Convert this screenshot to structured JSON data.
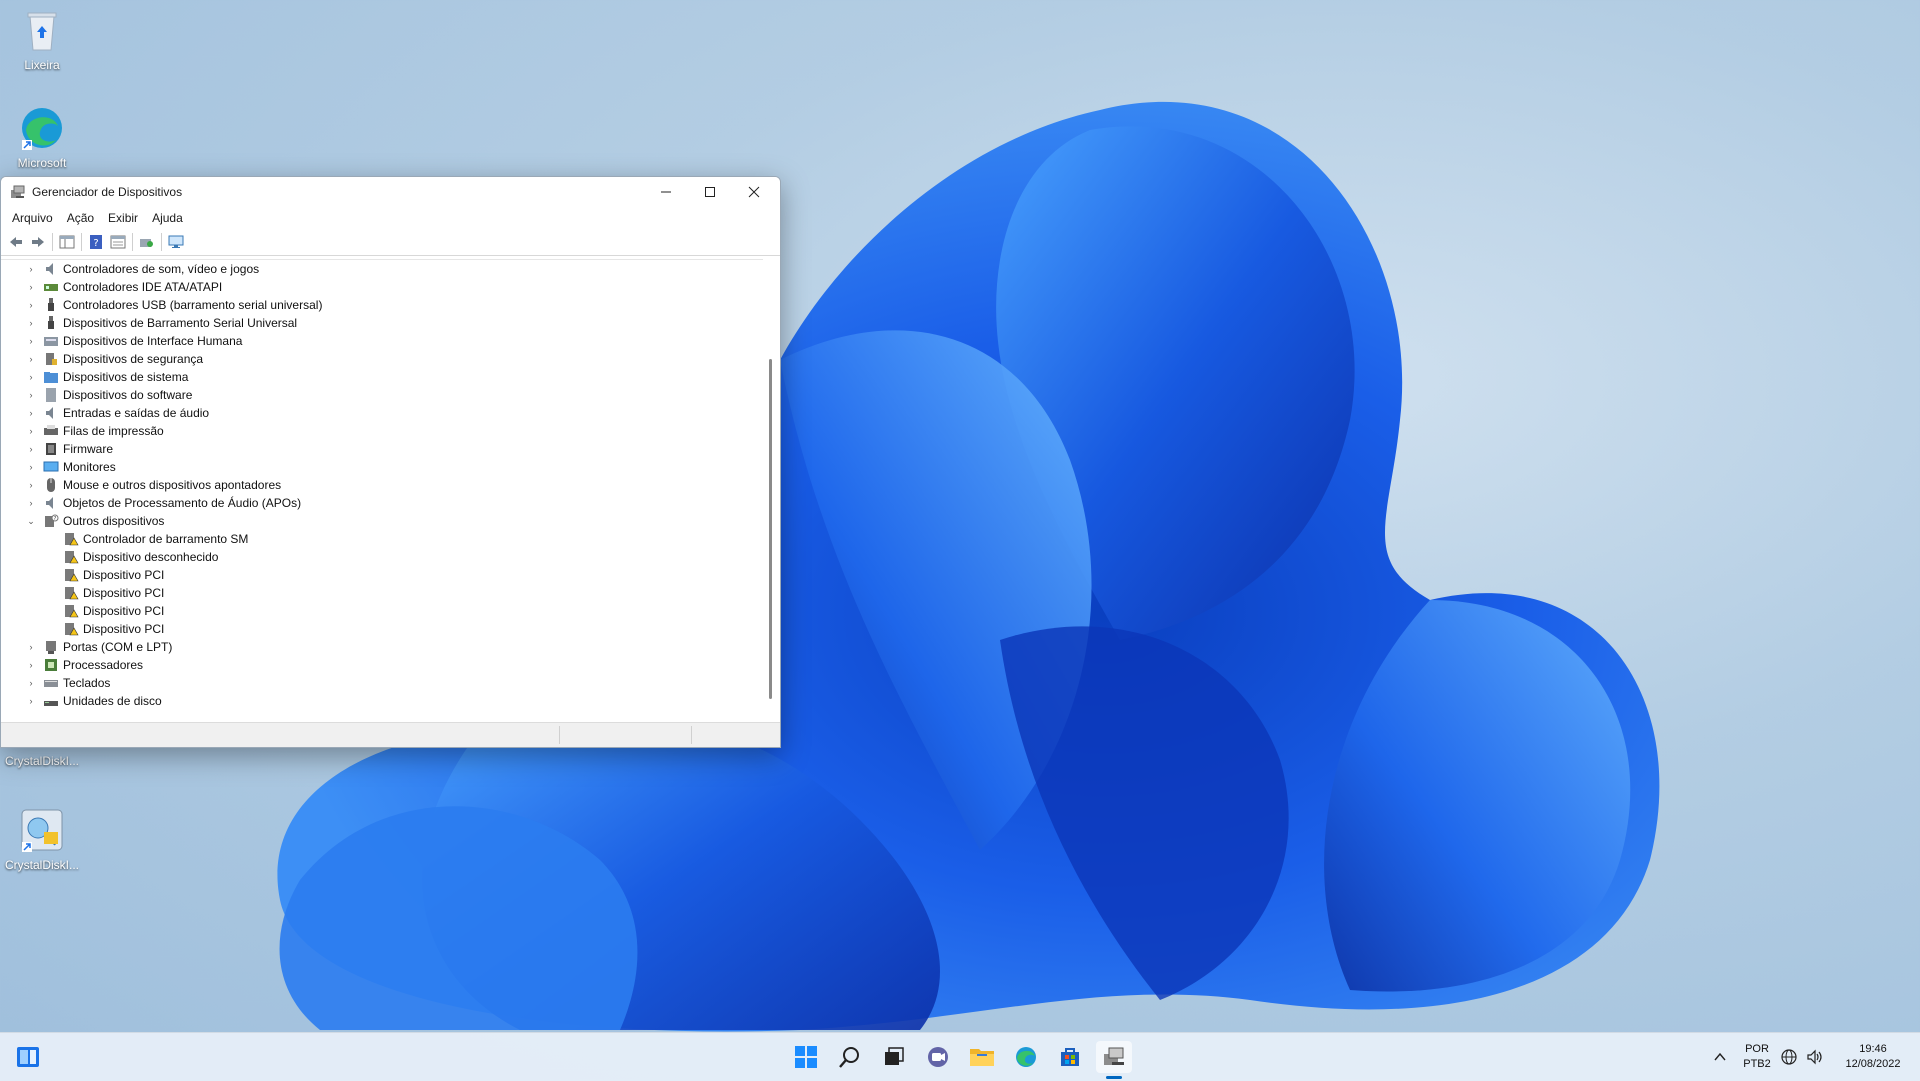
{
  "desktop": {
    "icons": [
      {
        "label": "Lixeira"
      },
      {
        "label": "Microsoft"
      },
      {
        "label": "CrystalDiskI..."
      },
      {
        "label": "CrystalDiskI..."
      }
    ]
  },
  "window": {
    "title": "Gerenciador de Dispositivos",
    "menu": [
      "Arquivo",
      "Ação",
      "Exibir",
      "Ajuda"
    ],
    "tree": [
      {
        "label": "Controladores de som, vídeo e jogos",
        "icon": "speaker-icon"
      },
      {
        "label": "Controladores IDE ATA/ATAPI",
        "icon": "ide-controller-icon"
      },
      {
        "label": "Controladores USB (barramento serial universal)",
        "icon": "usb-icon"
      },
      {
        "label": "Dispositivos de Barramento Serial Universal",
        "icon": "usb-icon"
      },
      {
        "label": "Dispositivos de Interface Humana",
        "icon": "hid-icon"
      },
      {
        "label": "Dispositivos de segurança",
        "icon": "security-device-icon"
      },
      {
        "label": "Dispositivos de sistema",
        "icon": "system-folder-icon"
      },
      {
        "label": "Dispositivos do software",
        "icon": "software-device-icon"
      },
      {
        "label": "Entradas e saídas de áudio",
        "icon": "speaker-icon"
      },
      {
        "label": "Filas de impressão",
        "icon": "printer-icon"
      },
      {
        "label": "Firmware",
        "icon": "firmware-icon"
      },
      {
        "label": "Monitores",
        "icon": "monitor-icon"
      },
      {
        "label": "Mouse e outros dispositivos apontadores",
        "icon": "mouse-icon"
      },
      {
        "label": "Objetos de Processamento de Áudio (APOs)",
        "icon": "speaker-icon"
      },
      {
        "label": "Outros dispositivos",
        "icon": "unknown-device-icon",
        "expanded": true
      }
    ],
    "other_devices": [
      "Controlador de barramento SM",
      "Dispositivo desconhecido",
      "Dispositivo PCI",
      "Dispositivo PCI",
      "Dispositivo PCI",
      "Dispositivo PCI"
    ],
    "tree_after": [
      {
        "label": "Portas (COM e LPT)",
        "icon": "port-icon"
      },
      {
        "label": "Processadores",
        "icon": "cpu-icon"
      },
      {
        "label": "Teclados",
        "icon": "keyboard-icon"
      },
      {
        "label": "Unidades de disco",
        "icon": "disk-drive-icon"
      }
    ]
  },
  "tray": {
    "lang_top": "POR",
    "lang_bottom": "PTB2",
    "time": "19:46",
    "date": "12/08/2022"
  },
  "colors": {
    "accent": "#0067c0",
    "warning": "#f5c518"
  }
}
